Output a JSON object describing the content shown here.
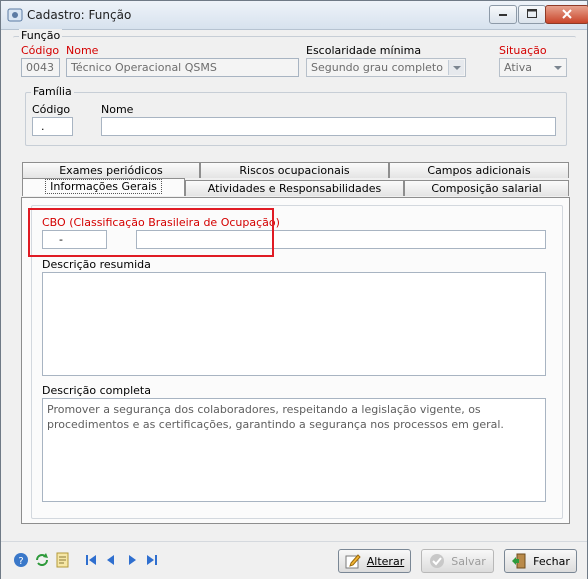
{
  "window": {
    "title": "Cadastro: Função"
  },
  "funcao": {
    "group_label": "Função",
    "codigo_label": "Código",
    "codigo_value": "0043",
    "nome_label": "Nome",
    "nome_value": "Técnico Operacional QSMS",
    "escolaridade_label": "Escolaridade mínima",
    "escolaridade_value": "Segundo grau completo",
    "situacao_label": "Situação",
    "situacao_value": "Ativa"
  },
  "familia": {
    "group_label": "Família",
    "codigo_label": "Código",
    "codigo_value": ".",
    "nome_label": "Nome",
    "nome_value": ""
  },
  "tabs": {
    "row1": [
      "Exames periódicos",
      "Riscos ocupacionais",
      "Campos adicionais"
    ],
    "row2": [
      "Informações Gerais",
      "Atividades e Responsabilidades",
      "Composição salarial"
    ],
    "active": "Informações Gerais"
  },
  "info": {
    "cbo_label": "CBO (Classificação Brasileira de Ocupação)",
    "cbo_code_value": "-",
    "cbo_desc_value": "",
    "desc_resumida_label": "Descrição resumida",
    "desc_resumida_value": "",
    "desc_completa_label": "Descrição completa",
    "desc_completa_value": "Promover a segurança dos colaboradores, respeitando a legislação vigente, os procedimentos e as certificações, garantindo a segurança nos processos em geral."
  },
  "footer": {
    "alterar_label": "Alterar",
    "salvar_label": "Salvar",
    "fechar_label": "Fechar"
  },
  "colors": {
    "required_label": "#d40000",
    "highlight_box": "#e01b24"
  }
}
